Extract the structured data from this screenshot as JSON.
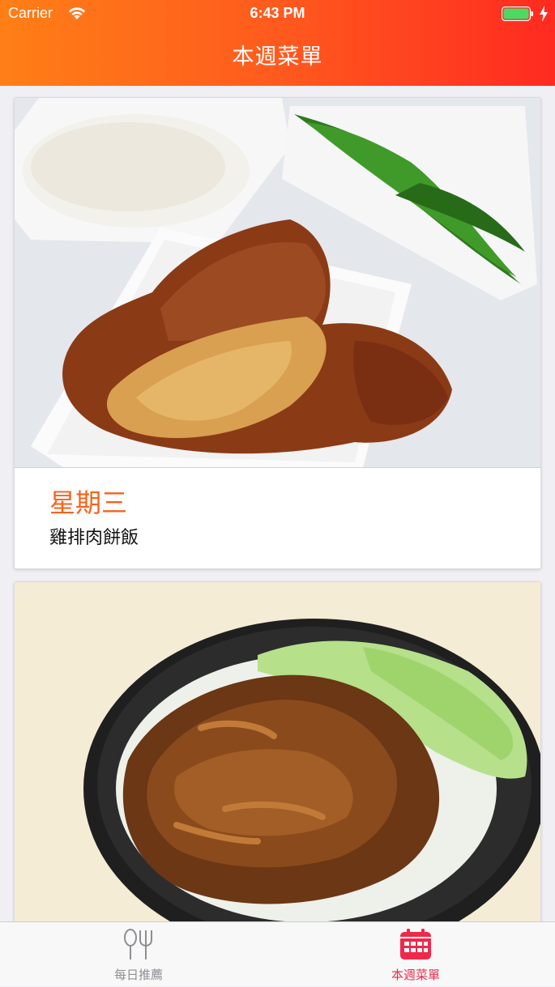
{
  "status_bar": {
    "carrier": "Carrier",
    "time": "6:43 PM"
  },
  "header": {
    "title": "本週菜單"
  },
  "cards": [
    {
      "day": "星期三",
      "dish": "雞排肉餅飯"
    }
  ],
  "tabs": [
    {
      "label": "每日推薦",
      "icon": "utensils-icon",
      "selected": false
    },
    {
      "label": "本週菜單",
      "icon": "calendar-icon",
      "selected": true
    }
  ],
  "colors": {
    "header_start": "#ff7f16",
    "header_end": "#ff2a20",
    "day_text": "#f5631c",
    "tab_active": "#f0284a",
    "tab_inactive": "#8e8e93"
  }
}
